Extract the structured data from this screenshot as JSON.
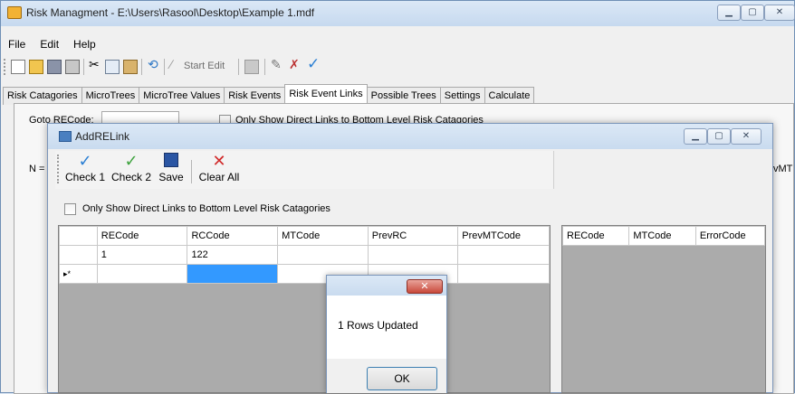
{
  "window": {
    "title": "Risk Managment - E:\\Users\\Rasool\\Desktop\\Example 1.mdf",
    "minimize": "▁",
    "maximize": "▢",
    "close": "✕"
  },
  "menu": [
    "File",
    "Edit",
    "Help"
  ],
  "toolbar": {
    "start_edit": "Start Edit"
  },
  "tabs": [
    "Risk Catagories",
    "MicroTrees",
    "MicroTree Values",
    "Risk Events",
    "Risk Event Links",
    "Possible Trees",
    "Settings",
    "Calculate"
  ],
  "active_tab": "Risk Event Links",
  "panel": {
    "goto_label": "Goto RECode:",
    "only_show_label": "Only Show Direct Links to Bottom Level Risk Catagories",
    "n_label": "N = ",
    "right_cut_label": "vMT"
  },
  "dialog": {
    "title": "AddRELink",
    "buttons": {
      "check1": "Check 1",
      "check2": "Check 2",
      "save": "Save",
      "clear_all": "Clear All"
    },
    "checkbox_label": "Only Show Direct Links to Bottom Level Risk Catagories",
    "grid1": {
      "columns": [
        "RECode",
        "RCCode",
        "MTCode",
        "PrevRC",
        "PrevMTCode"
      ],
      "rows": [
        [
          "1",
          "122",
          "",
          "",
          ""
        ]
      ],
      "new_row_marker": "▸*"
    },
    "grid2": {
      "columns": [
        "RECode",
        "MTCode",
        "ErrorCode"
      ]
    }
  },
  "message_box": {
    "text": "1 Rows Updated",
    "ok": "OK",
    "close": "✕"
  }
}
